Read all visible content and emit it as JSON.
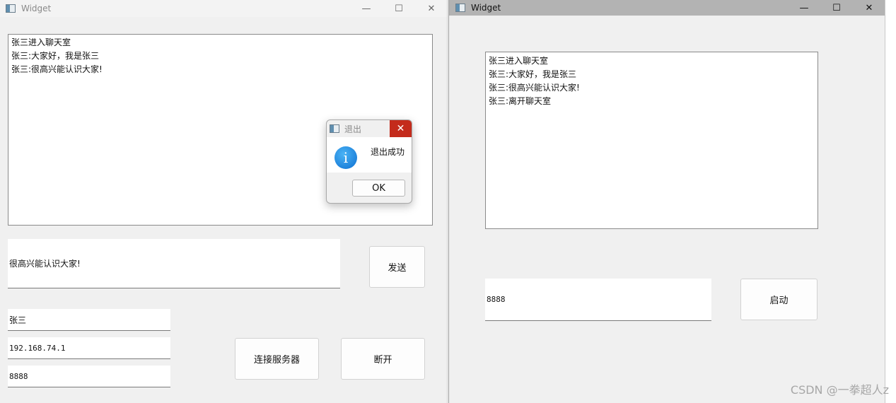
{
  "client": {
    "title": "Widget",
    "chat_lines": [
      "张三进入聊天室",
      "张三:大家好，我是张三",
      "张三:很高兴能认识大家!"
    ],
    "message_input": "很高兴能认识大家!",
    "send_label": "发送",
    "username": "张三",
    "ip": "192.168.74.1",
    "port": "8888",
    "connect_label": "连接服务器",
    "disconnect_label": "断开"
  },
  "dialog": {
    "title": "退出",
    "message": "退出成功",
    "ok_label": "OK"
  },
  "server": {
    "title": "Widget",
    "chat_lines": [
      "张三进入聊天室",
      "张三:大家好，我是张三",
      "张三:很高兴能认识大家!",
      "张三:离开聊天室"
    ],
    "port": "8888",
    "start_label": "启动"
  },
  "window_controls": {
    "minimize": "—",
    "maximize": "☐",
    "close": "✕"
  },
  "watermark": "CSDN @一拳超人z",
  "icons": [
    "app-icon",
    "info-icon",
    "minimize-icon",
    "maximize-icon",
    "close-icon"
  ],
  "colors": {
    "dialog_close": "#c42b1c",
    "info_icon": "#1a7fe0"
  }
}
